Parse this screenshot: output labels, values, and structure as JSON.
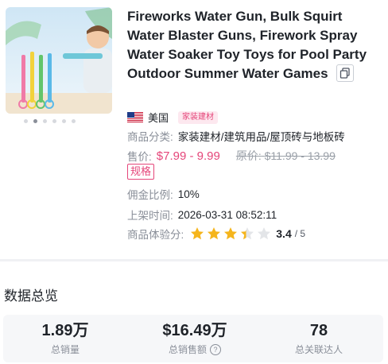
{
  "product": {
    "title": "Fireworks Water Gun, Bulk Squirt Water Blaster Guns, Firework Spray Water Soaker Toy Toys for Pool Party Outdoor Summer Water Games",
    "region": {
      "flag_icon": "us-flag-icon",
      "name": "美国"
    },
    "category_badge": "家装建材",
    "category": {
      "label": "商品分类:",
      "value": "家装建材/建筑用品/屋顶砖与地板砖"
    },
    "price": {
      "label": "售价:",
      "value": "$7.99 - 9.99",
      "original_label": "原价:",
      "original_value": "$11.99 - 13.99"
    },
    "spec_tag": "规格",
    "commission": {
      "label": "佣金比例:",
      "value": "10%"
    },
    "listed": {
      "label": "上架时间:",
      "value": "2026-03-31 08:52:11"
    },
    "rating": {
      "label": "商品体验分:",
      "score": "3.4",
      "max": "/ 5",
      "value": 3.4
    },
    "gallery": {
      "count": 6,
      "active_index": 1
    }
  },
  "overview": {
    "title": "数据总览",
    "stats": [
      {
        "value": "1.89万",
        "label": "总销量"
      },
      {
        "value": "$16.49万",
        "label": "总销售额"
      },
      {
        "value": "78",
        "label": "总关联达人"
      }
    ]
  },
  "colors": {
    "accent": "#e5467a",
    "star": "#f5b51c",
    "muted": "#8a8f99"
  }
}
